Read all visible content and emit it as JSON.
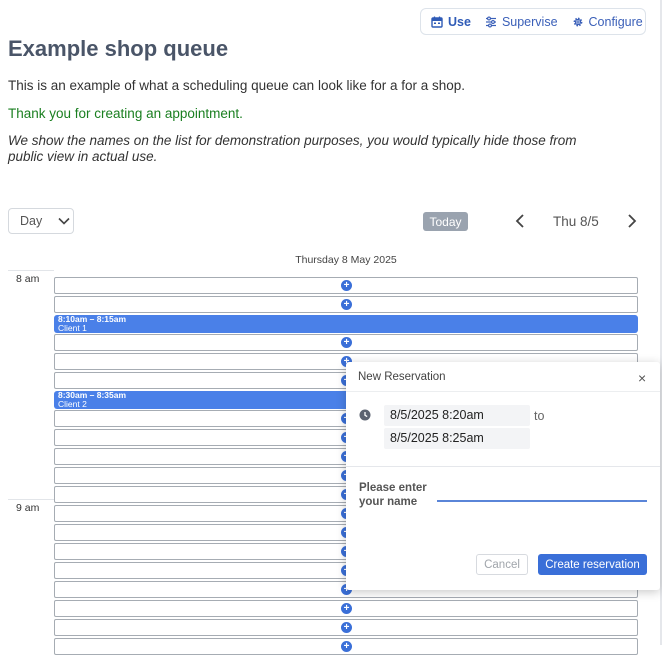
{
  "nav": {
    "use": "Use",
    "supervise": "Supervise",
    "configure": "Configure"
  },
  "page": {
    "title": "Example shop queue",
    "intro": "This is an example of what a scheduling queue can look like for a for a shop.",
    "success": "Thank you for creating an appointment.",
    "note": "We show the names on the list for demonstration purposes, you would typically hide those from public view in actual use."
  },
  "toolbar": {
    "view_select": "Day",
    "today_label": "Today",
    "current_date": "Thu 8/5"
  },
  "calendar": {
    "day_header": "Thursday 8 May 2025",
    "hours": [
      "8 am",
      "9 am"
    ],
    "events": [
      {
        "time": "8:10am – 8:15am",
        "client": "Client 1"
      },
      {
        "time": "8:30am – 8:35am",
        "client": "Client 2"
      }
    ],
    "add_symbol": "+"
  },
  "dialog": {
    "title": "New Reservation",
    "close_symbol": "×",
    "start": "8/5/2025 8:20am",
    "to_label": "to",
    "end": "8/5/2025 8:25am",
    "name_label": "Please enter your name",
    "name_value": "",
    "cancel_label": "Cancel",
    "create_label": "Create reservation"
  },
  "colors": {
    "accent": "#3a6fd8",
    "event": "#4a80e8",
    "success_text": "#1a7f20",
    "today_button": "#9aa3af"
  },
  "icons": {
    "use": "calendar-icon",
    "supervise": "sliders-icon",
    "configure": "gear-icon",
    "prev": "chevron-left-icon",
    "next": "chevron-right-icon",
    "time": "clock-icon"
  }
}
